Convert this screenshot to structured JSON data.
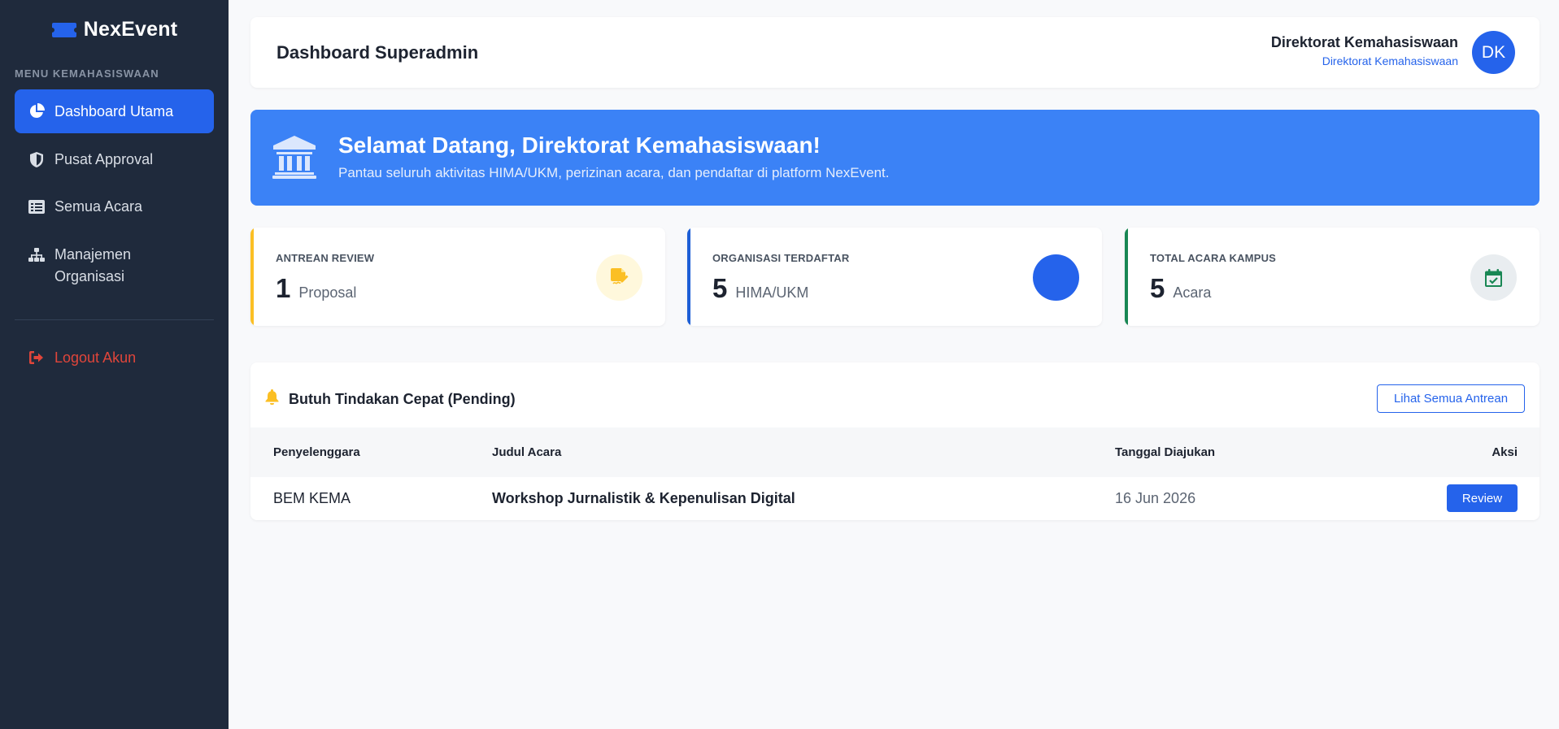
{
  "sidebar": {
    "brand": "NexEvent",
    "menu_heading": "MENU KEMAHASISWAAN",
    "items": [
      {
        "label": "Dashboard Utama",
        "icon": "pie-chart-icon",
        "active": true
      },
      {
        "label": "Pusat Approval",
        "icon": "shield-icon"
      },
      {
        "label": "Semua Acara",
        "icon": "list-icon"
      },
      {
        "label": "Manajemen Organisasi",
        "icon": "sitemap-icon"
      }
    ],
    "logout_label": "Logout Akun"
  },
  "header": {
    "title": "Dashboard Superadmin",
    "user_name": "Direktorat Kemahasiswaan",
    "user_role": "Direktorat Kemahasiswaan",
    "avatar_initials": "DK"
  },
  "banner": {
    "title": "Selamat Datang, Direktorat Kemahasiswaan!",
    "subtitle": "Pantau seluruh aktivitas HIMA/UKM, perizinan acara, dan pendaftar di platform NexEvent."
  },
  "stats": [
    {
      "label": "ANTREAN REVIEW",
      "value": "1",
      "unit": "Proposal",
      "icon": "file-signature-icon",
      "accent": "#fbbf24"
    },
    {
      "label": "ORGANISASI TERDAFTAR",
      "value": "5",
      "unit": "HIMA/UKM",
      "icon": "organization-icon",
      "accent": "#1d5fd6"
    },
    {
      "label": "TOTAL ACARA KAMPUS",
      "value": "5",
      "unit": "Acara",
      "icon": "calendar-check-icon",
      "accent": "#198754"
    }
  ],
  "pending": {
    "title": "Butuh Tindakan Cepat (Pending)",
    "see_all_label": "Lihat Semua Antrean",
    "columns": [
      "Penyelenggara",
      "Judul Acara",
      "Tanggal Diajukan",
      "Aksi"
    ],
    "rows": [
      {
        "organizer": "BEM KEMA",
        "event_title": "Workshop Jurnalistik & Kepenulisan Digital",
        "date": "16 Jun 2026",
        "action_label": "Review"
      }
    ]
  },
  "colors": {
    "sidebar_bg": "#1f2a3c",
    "primary": "#2563eb",
    "banner_bg": "#3b82f6",
    "logout": "#e0453a"
  }
}
